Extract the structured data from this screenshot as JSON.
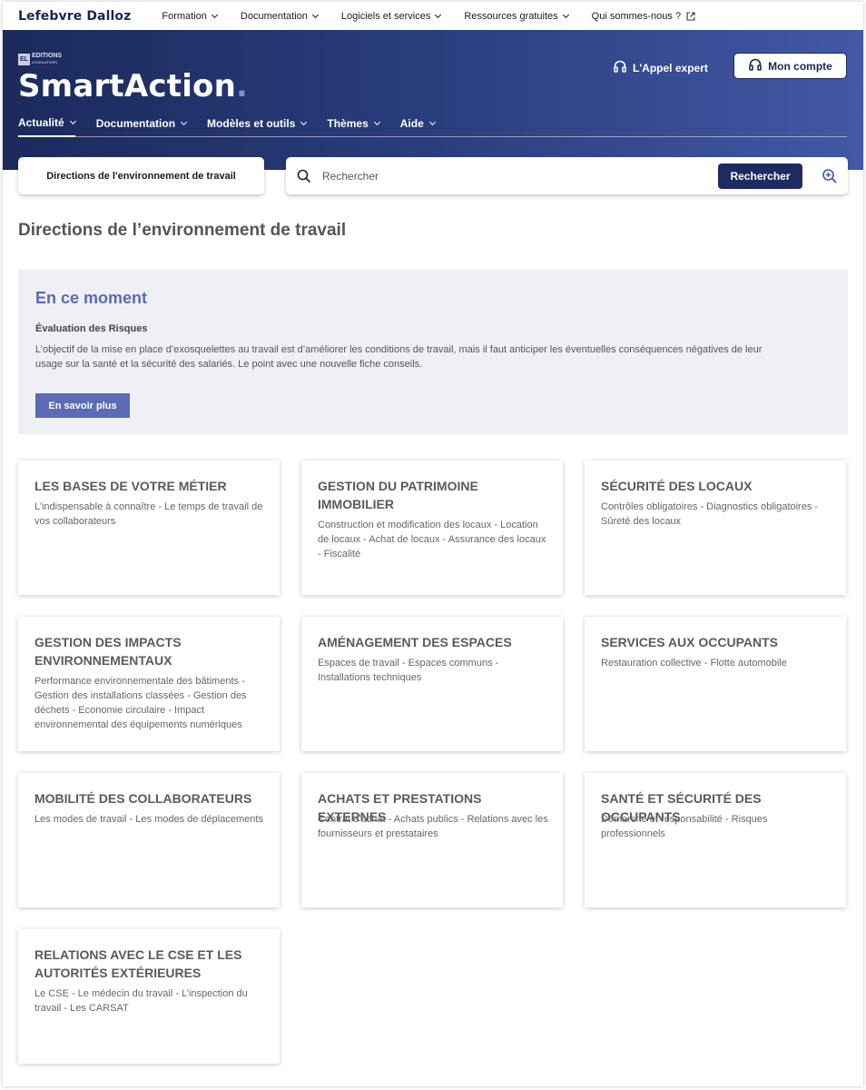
{
  "topnav": {
    "brand": "Lefebvre Dalloz",
    "links": [
      "Formation",
      "Documentation",
      "Logiciels et services",
      "Ressources gratuites",
      "Qui sommes-nous ?"
    ]
  },
  "hero": {
    "editions_logo_mark": "EL",
    "editions_logo_line1": "EDITIONS",
    "editions_logo_line2": "LÉGISLATIVES",
    "product_name": "SmartAction",
    "product_dot": ".",
    "expert_label": "L'Appel expert",
    "account_label": "Mon compte",
    "nav": [
      "Actualité",
      "Documentation",
      "Modèles et outils",
      "Thèmes",
      "Aide"
    ],
    "active_nav": "Actualité"
  },
  "search": {
    "scope_label": "Directions de l'environnement de travail",
    "placeholder": "Rechercher",
    "button_label": "Rechercher"
  },
  "page_title": "Directions de l’environnement de travail",
  "moment": {
    "heading": "En ce moment",
    "subtitle": "Évaluation des Risques",
    "description": "L’objectif de la mise en place d’exosquelettes au travail est d’améliorer les conditions de travail, mais il faut anticiper les éventuelles conséquences négatives de leur usage sur la santé et la sécurité des salariés. Le point avec une nouvelle fiche conseils.",
    "button_label": "En savoir plus"
  },
  "cards": [
    {
      "title": "LES BASES DE VOTRE MÉTIER",
      "desc": "L’indispensable à connaître - Le temps de travail de vos collaborateurs"
    },
    {
      "title": "GESTION DU PATRIMOINE IMMOBILIER",
      "desc": "Construction et modification des locaux - Location de locaux - Achat de locaux - Assurance des locaux - Fiscalité"
    },
    {
      "title": "SÉCURITÉ DES LOCAUX",
      "desc": "Contrôles obligatoires - Diagnostics obligatoires - Sûreté des locaux"
    },
    {
      "title": "GESTION DES IMPACTS ENVIRONNEMENTAUX",
      "desc": "Performance environnementale des bâtiments - Gestion des installations classées - Gestion des déchets - Economie circulaire - Impact environnemental des équipements numériques"
    },
    {
      "title": "AMÉNAGEMENT DES ESPACES",
      "desc": "Espaces de travail - Espaces communs - Installations techniques"
    },
    {
      "title": "SERVICES AUX OCCUPANTS",
      "desc": "Restauration collective - Flotte automobile"
    },
    {
      "title": "MOBILITÉ DES COLLABORATEURS",
      "desc": "Les modes de travail - Les modes de déplacements"
    },
    {
      "title": "ACHATS ET PRESTATIONS EXTERNES",
      "desc": "Contrat d’achat  - Achats publics - Relations avec les fournisseurs et prestataires"
    },
    {
      "title": "SANTÉ ET SÉCURITÉ DES OCCUPANTS",
      "desc": "Démarche et responsabilité - Risques professionnels"
    },
    {
      "title": "RELATIONS AVEC LE CSE ET LES AUTORITÉS EXTÉRIEURES",
      "desc": "Le CSE - Le médecin du travail - L’inspection du travail - Les CARSAT"
    }
  ]
}
